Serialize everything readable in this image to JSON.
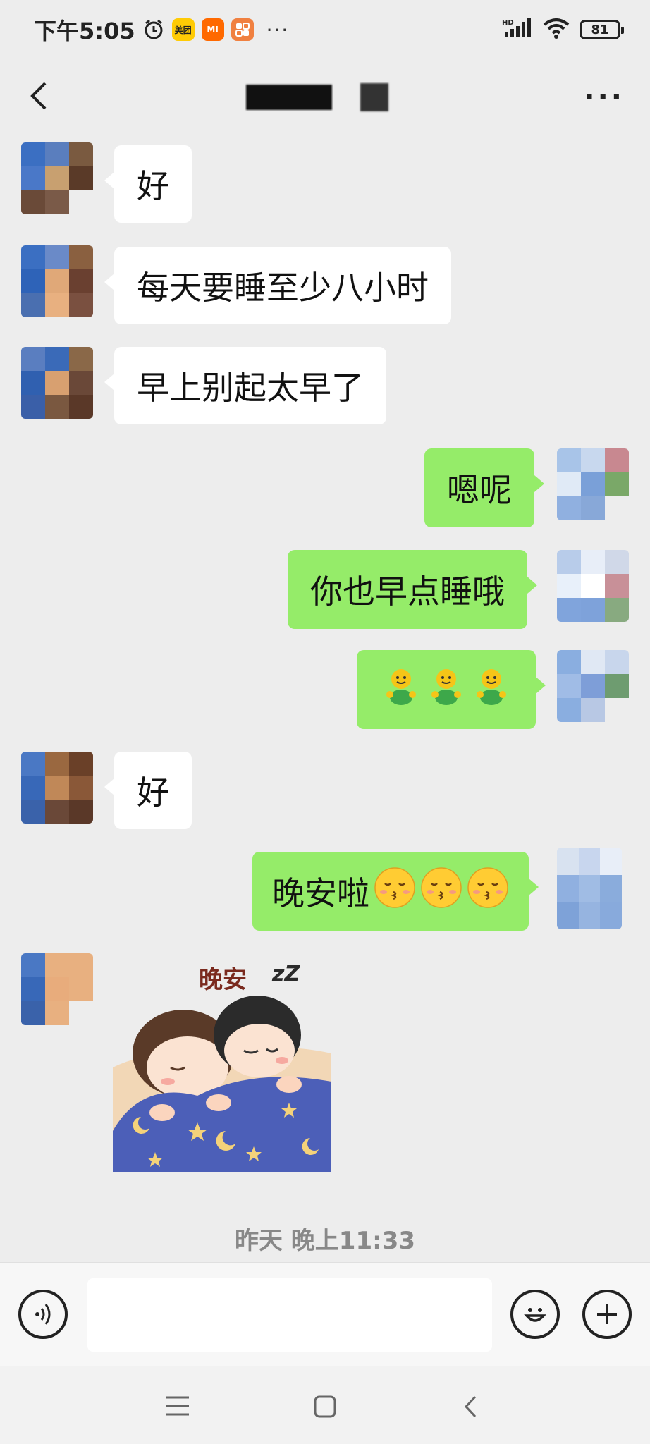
{
  "status_bar": {
    "time": "下午5:05",
    "app_badges": [
      {
        "name": "meituan-app-icon",
        "label": "美团",
        "color": "#FFCB05"
      },
      {
        "name": "mi-app-icon",
        "label": "MI",
        "color": "#FF6900"
      },
      {
        "name": "miui-app-icon",
        "label": "",
        "color": "#F08040"
      }
    ],
    "more": "···",
    "network": "HD",
    "battery": "81"
  },
  "title_bar": {
    "back_icon": "chevron-left-icon",
    "more_icon": "more-dots-icon",
    "more_label": "···"
  },
  "messages": [
    {
      "side": "left",
      "text": "好"
    },
    {
      "side": "left",
      "text": "每天要睡至少八小时"
    },
    {
      "side": "left",
      "text": "早上别起太早了"
    },
    {
      "side": "right",
      "text": "嗯呢"
    },
    {
      "side": "right",
      "text": "你也早点睡哦"
    },
    {
      "side": "right",
      "text": "",
      "emoji": [
        "smile-figure-emoji",
        "smile-figure-emoji",
        "smile-figure-emoji"
      ]
    },
    {
      "side": "left",
      "text": "好"
    },
    {
      "side": "right",
      "text": "晚安啦",
      "emoji": [
        "kissing-face-emoji",
        "kissing-face-emoji",
        "kissing-face-emoji"
      ]
    },
    {
      "side": "left",
      "sticker": "goodnight-couple-sticker",
      "sticker_text": "晚安",
      "sticker_zz": "zZ"
    }
  ],
  "timestamp": "昨天 晚上11:33",
  "input_bar": {
    "voice_icon": "voice-icon",
    "input_value": "",
    "emoji_icon": "emoji-icon",
    "plus_icon": "plus-icon"
  },
  "nav_bar": {
    "menu_icon": "menu-icon",
    "home_icon": "home-icon",
    "back_icon": "back-icon"
  },
  "colors": {
    "background": "#EDEDED",
    "bubble_right": "#95EC69",
    "bubble_left": "#FFFFFF"
  }
}
